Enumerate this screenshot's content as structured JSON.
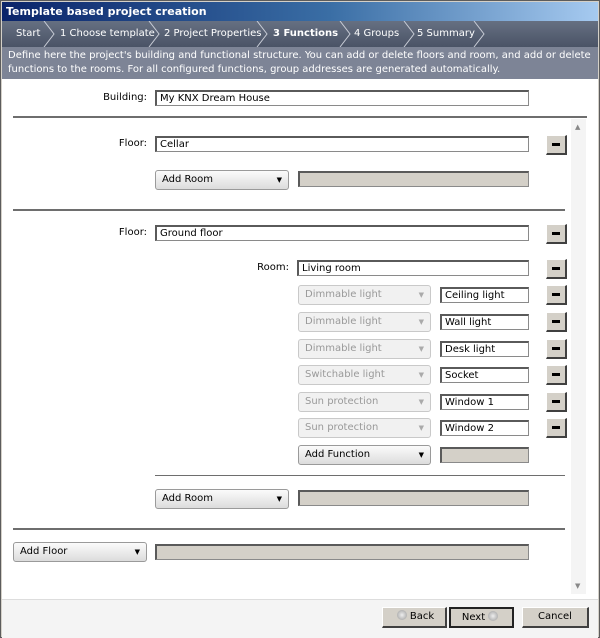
{
  "window": {
    "title": "Template based project creation"
  },
  "steps": [
    {
      "label": "Start",
      "active": false
    },
    {
      "label": "1 Choose template",
      "active": false
    },
    {
      "label": "2 Project Properties",
      "active": false
    },
    {
      "label": "3 Functions",
      "active": true
    },
    {
      "label": "4 Groups",
      "active": false
    },
    {
      "label": "5 Summary",
      "active": false
    }
  ],
  "description": "Define here the project's building and functional structure. You can add or delete floors and room, and add or delete functions to the rooms. For all configured functions, group addresses are generated automatically.",
  "building": {
    "label": "Building:",
    "value": "My KNX Dream House"
  },
  "floors": [
    {
      "label": "Floor:",
      "value": "Cellar",
      "add_room": "Add Room"
    },
    {
      "label": "Floor:",
      "value": "Ground floor",
      "add_room": "Add Room",
      "room": {
        "label": "Room:",
        "value": "Living room",
        "add_function": "Add Function",
        "functions": [
          {
            "type": "Dimmable light",
            "name": "Ceiling light"
          },
          {
            "type": "Dimmable light",
            "name": "Wall light"
          },
          {
            "type": "Dimmable light",
            "name": "Desk light"
          },
          {
            "type": "Switchable light",
            "name": "Socket"
          },
          {
            "type": "Sun protection",
            "name": "Window 1"
          },
          {
            "type": "Sun protection",
            "name": "Window 2"
          }
        ]
      }
    }
  ],
  "add_floor": "Add Floor",
  "icons": {
    "dropdown_arrow": "▼",
    "scroll_up": "▲",
    "scroll_down": "▼"
  },
  "footer": {
    "back": "Back",
    "next": "Next",
    "cancel": "Cancel"
  }
}
